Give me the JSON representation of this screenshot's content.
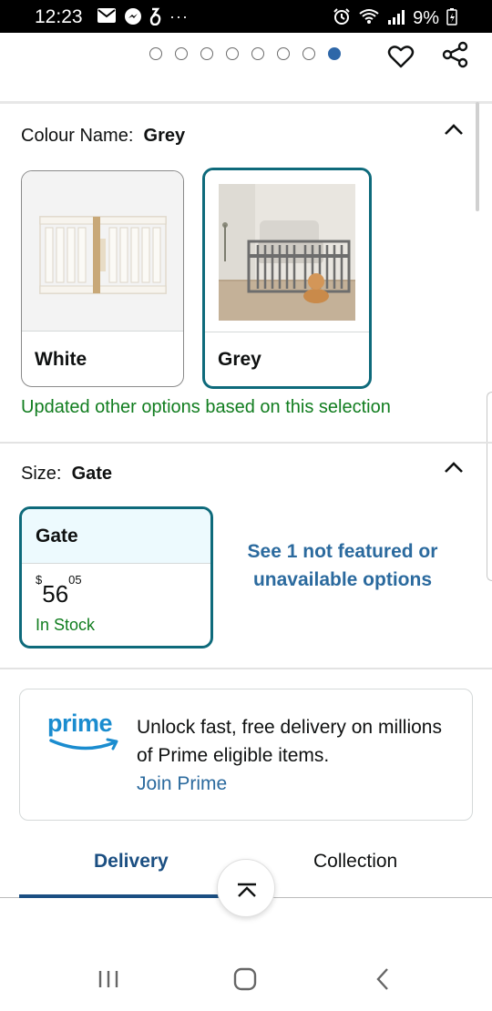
{
  "status_bar": {
    "time": "12:23",
    "battery": "9%"
  },
  "carousel": {
    "dot_count": 8,
    "active_index": 7
  },
  "colour": {
    "label": "Colour Name:",
    "value": "Grey",
    "options": [
      {
        "name": "White",
        "selected": false
      },
      {
        "name": "Grey",
        "selected": true
      }
    ],
    "notice": "Updated other options based on this selection"
  },
  "size": {
    "label": "Size:",
    "value": "Gate",
    "option": {
      "name": "Gate",
      "price_symbol": "$",
      "price_whole": "56",
      "price_fraction": "05",
      "availability": "In Stock"
    },
    "see_more": "See 1 not featured or unavailable options"
  },
  "prime": {
    "logo_text": "prime",
    "message": "Unlock fast, free delivery on millions of Prime eligible items.",
    "link": "Join Prime"
  },
  "tabs": [
    {
      "label": "Delivery",
      "active": true
    },
    {
      "label": "Collection",
      "active": false
    }
  ],
  "colors": {
    "accent_teal": "#0e6a7b",
    "link_blue": "#2b6a9e",
    "in_stock_green": "#117d1f",
    "active_dot": "#2e67a8"
  }
}
